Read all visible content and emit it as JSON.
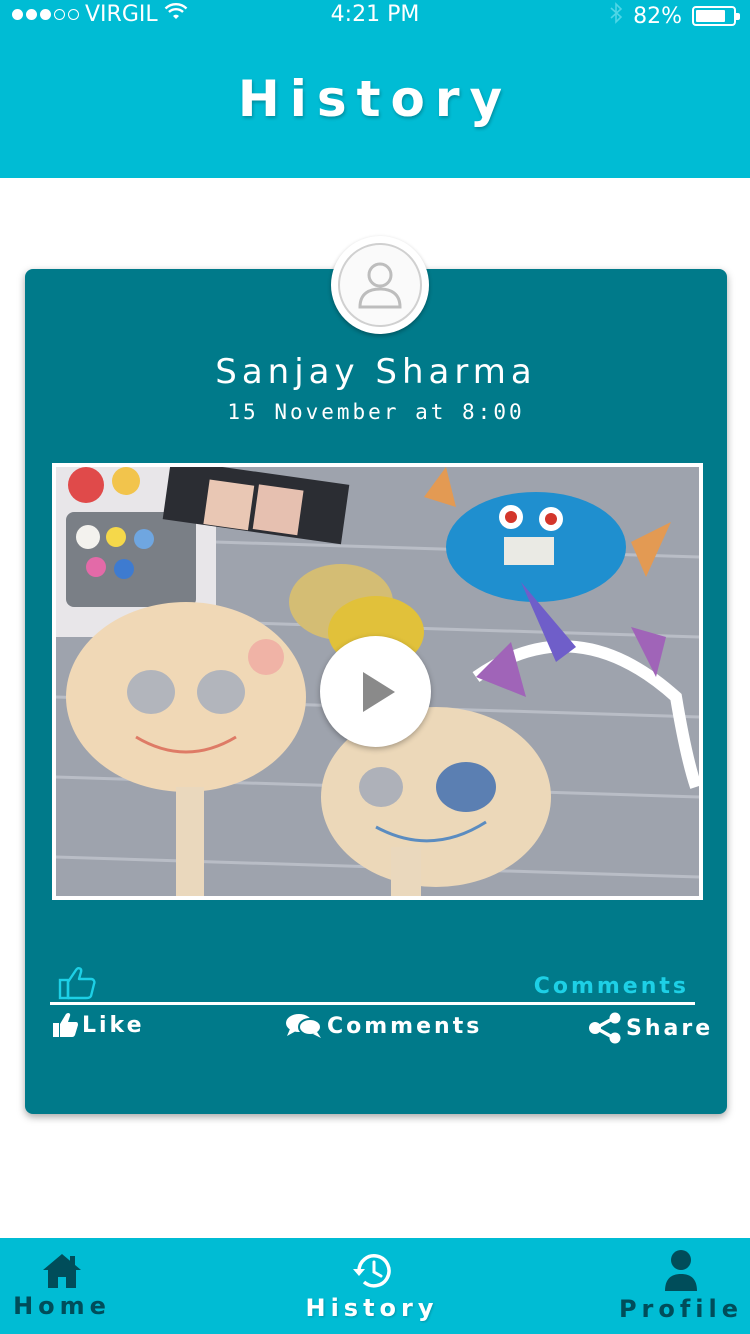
{
  "status_bar": {
    "carrier": "VIRGIL",
    "time": "4:21 PM",
    "battery_percent": "82%",
    "battery_level": 0.82,
    "signal_dots": [
      true,
      true,
      true,
      false,
      false
    ]
  },
  "header": {
    "title": "History"
  },
  "post": {
    "author": "Sanjay Sharma",
    "date": "15 November at 8:00",
    "comments_link": "Comments",
    "actions": {
      "like": "Like",
      "comments": "Comments",
      "share": "Share"
    }
  },
  "nav": {
    "home": "Home",
    "history": "History",
    "profile": "Profile"
  },
  "colors": {
    "primary": "#00bcd4",
    "card": "#007a8a",
    "nav_inactive": "#004d5a",
    "comments_link": "#1dd0e6"
  }
}
